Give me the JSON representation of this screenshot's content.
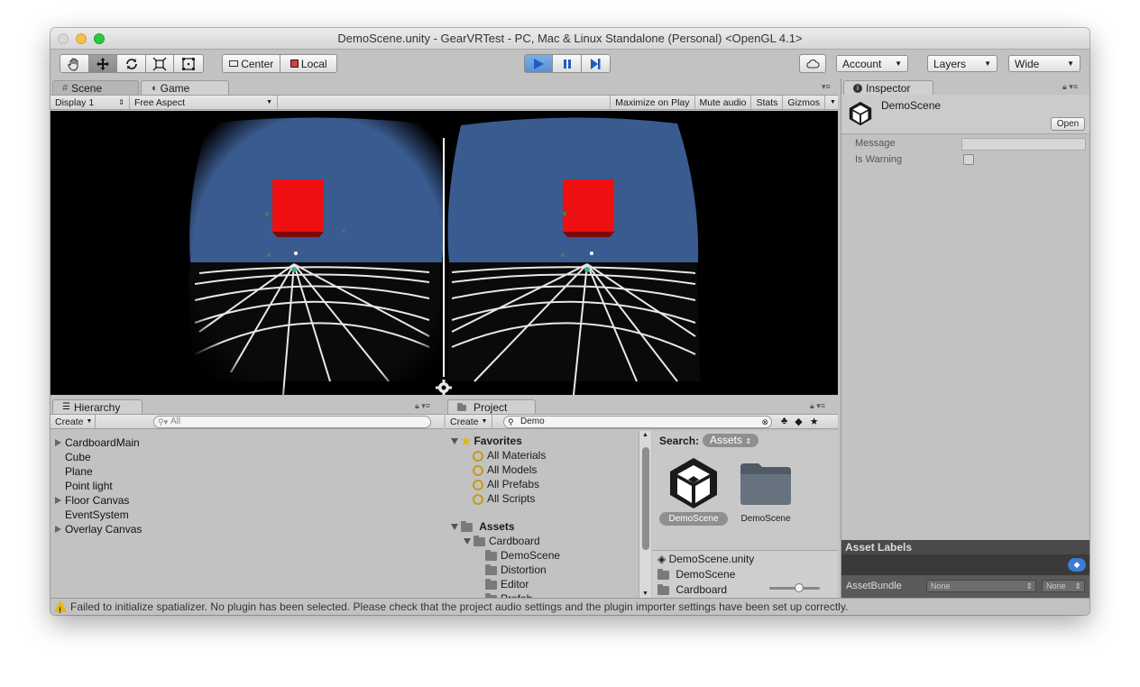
{
  "window": {
    "title": "DemoScene.unity - GearVRTest - PC, Mac & Linux Standalone (Personal) <OpenGL 4.1>"
  },
  "toolbar": {
    "pivot_center": "Center",
    "pivot_local": "Local",
    "account": "Account",
    "layers": "Layers",
    "layout": "Wide"
  },
  "scene_game": {
    "tab_scene": "Scene",
    "tab_game": "Game",
    "display": "Display 1",
    "aspect": "Free Aspect",
    "maximize": "Maximize on Play",
    "mute": "Mute audio",
    "stats": "Stats",
    "gizmos": "Gizmos"
  },
  "hierarchy": {
    "tab": "Hierarchy",
    "create": "Create",
    "search_placeholder": "All",
    "items": [
      {
        "label": "CardboardMain",
        "expandable": true
      },
      {
        "label": "Cube",
        "expandable": false
      },
      {
        "label": "Plane",
        "expandable": false
      },
      {
        "label": "Point light",
        "expandable": false
      },
      {
        "label": "Floor Canvas",
        "expandable": true
      },
      {
        "label": "EventSystem",
        "expandable": false
      },
      {
        "label": "Overlay Canvas",
        "expandable": true
      }
    ]
  },
  "project": {
    "tab": "Project",
    "create": "Create",
    "search_value": "Demo",
    "favorites_label": "Favorites",
    "favorites": [
      "All Materials",
      "All Models",
      "All Prefabs",
      "All Scripts"
    ],
    "assets_label": "Assets",
    "tree": [
      {
        "label": "Cardboard",
        "level": 1
      },
      {
        "label": "DemoScene",
        "level": 2
      },
      {
        "label": "Distortion",
        "level": 2
      },
      {
        "label": "Editor",
        "level": 2
      },
      {
        "label": "Prefab",
        "level": 2
      }
    ],
    "search_label": "Search:",
    "search_scope": "Assets",
    "grid_items": [
      {
        "label": "DemoScene",
        "kind": "unity-scene-icon",
        "selected": true
      },
      {
        "label": "DemoScene",
        "kind": "folder-icon",
        "selected": false
      }
    ],
    "list_items": [
      {
        "label": "DemoScene.unity",
        "kind": "unity-scene-icon"
      },
      {
        "label": "DemoScene",
        "kind": "folder-icon"
      },
      {
        "label": "Cardboard",
        "kind": "folder-icon"
      }
    ]
  },
  "inspector": {
    "tab": "Inspector",
    "object_name": "DemoScene",
    "open_button": "Open",
    "fields": [
      {
        "label": "Message",
        "type": "text",
        "value": ""
      },
      {
        "label": "Is Warning",
        "type": "checkbox",
        "value": false
      }
    ],
    "asset_labels": "Asset Labels",
    "assetbundle_label": "AssetBundle",
    "assetbundle_value": "None",
    "assetbundle_variant": "None"
  },
  "status": {
    "message": "Failed to initialize spatializer. No plugin has been selected. Please check that the project audio settings and the plugin importer settings have been set up correctly."
  }
}
